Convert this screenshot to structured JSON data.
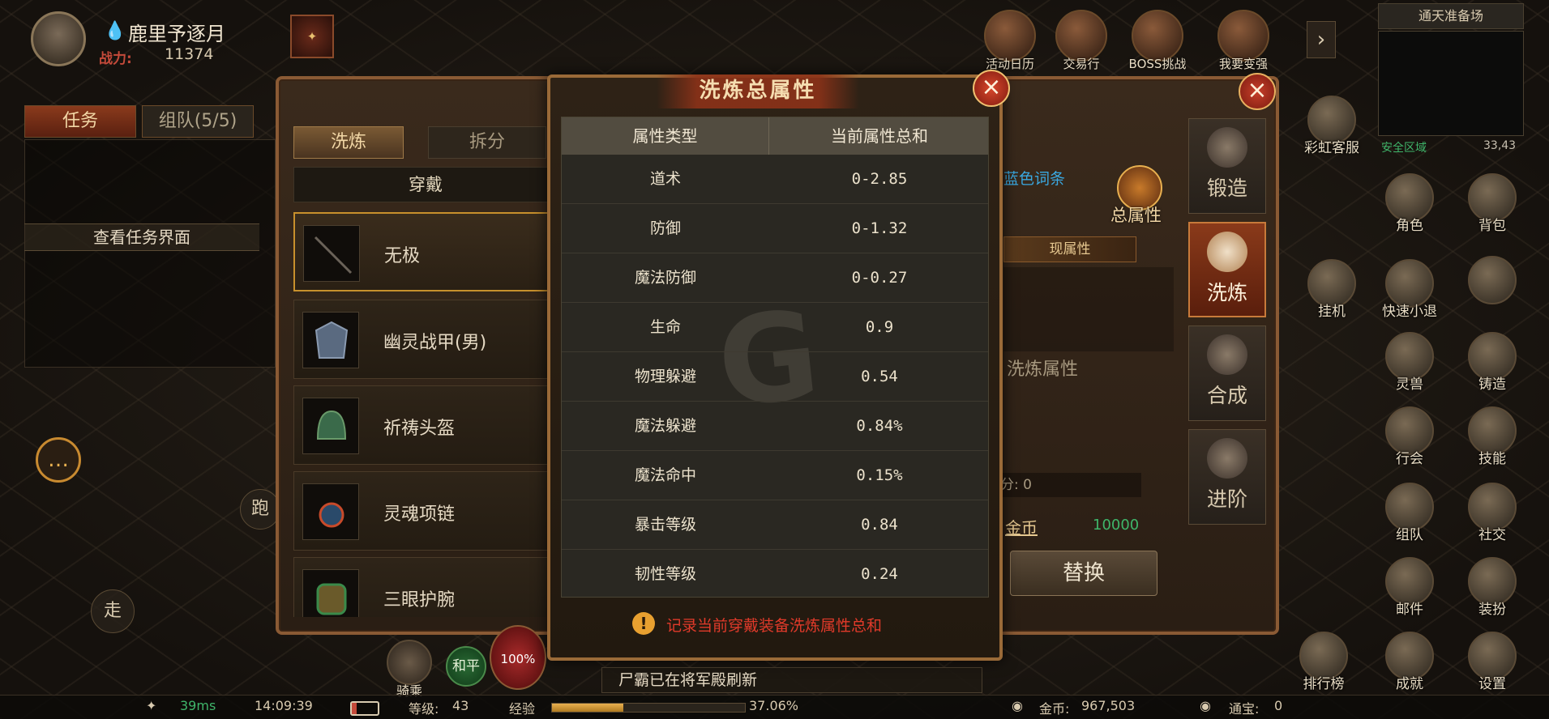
{
  "player": {
    "name": "鹿里予逐月",
    "power_label": "战力:",
    "power_value": "11374",
    "buff_icon": "buff-icon"
  },
  "top_icons": [
    {
      "label": "活动日历",
      "icon": "calendar-icon"
    },
    {
      "label": "交易行",
      "icon": "trade-icon"
    },
    {
      "label": "BOSS挑战",
      "icon": "boss-icon"
    },
    {
      "label": "我要变强",
      "icon": "strengthen-icon"
    }
  ],
  "minimap": {
    "title": "通天准备场",
    "safe_zone": "安全区域",
    "coords": "33,43"
  },
  "customer_service": "彩虹客服",
  "task_panel": {
    "tab_tasks": "任务",
    "tab_team": "组队(5/5)",
    "view_tasks": "查看任务界面"
  },
  "controls": {
    "run": "跑",
    "walk": "走",
    "mount": "骑乘",
    "peace": "和平",
    "hp_percent": "100%"
  },
  "smelt_window": {
    "tab_smelt": "洗炼",
    "tab_split": "拆分",
    "wear_select": "穿戴",
    "items": [
      {
        "name": "无极",
        "icon": "staff-icon"
      },
      {
        "name": "幽灵战甲(男)",
        "icon": "armor-icon"
      },
      {
        "name": "祈祷头盔",
        "icon": "helmet-icon"
      },
      {
        "name": "灵魂项链",
        "icon": "necklace-icon"
      },
      {
        "name": "三眼护腕",
        "icon": "bracer-icon"
      }
    ],
    "blue_affix": "蓝色词条",
    "total_attr_label": "总属性",
    "current_attr": "现属性",
    "smelt_attr": "洗炼属性",
    "points": "分: 0",
    "gold_label": "金币",
    "gold_cost": "10000",
    "replace_button": "替换"
  },
  "side_tabs": [
    {
      "label": "锻造",
      "icon": "forge-icon"
    },
    {
      "label": "洗炼",
      "icon": "smelt-icon"
    },
    {
      "label": "合成",
      "icon": "compose-icon"
    },
    {
      "label": "进阶",
      "icon": "advance-icon"
    }
  ],
  "game_icons": {
    "role": "角色",
    "bag": "背包",
    "afk": "挂机",
    "quick_exit": "快速小退",
    "close": "",
    "spirit_beast": "灵兽",
    "craft": "铸造",
    "guild": "行会",
    "skill": "技能",
    "team": "组队",
    "social": "社交",
    "mail": "邮件",
    "dress": "装扮",
    "ranking": "排行榜",
    "achievement": "成就",
    "settings": "设置"
  },
  "dialog": {
    "title": "洗炼总属性",
    "header_type": "属性类型",
    "header_total": "当前属性总和",
    "rows": [
      {
        "type": "道术",
        "value": "0-2.85"
      },
      {
        "type": "防御",
        "value": "0-1.32"
      },
      {
        "type": "魔法防御",
        "value": "0-0.27"
      },
      {
        "type": "生命",
        "value": "0.9"
      },
      {
        "type": "物理躲避",
        "value": "0.54"
      },
      {
        "type": "魔法躲避",
        "value": "0.84%"
      },
      {
        "type": "魔法命中",
        "value": "0.15%"
      },
      {
        "type": "暴击等级",
        "value": "0.84"
      },
      {
        "type": "韧性等级",
        "value": "0.24"
      }
    ],
    "note": "记录当前穿戴装备洗炼属性总和",
    "watermark": "G"
  },
  "news": "尸霸已在将军殿刷新",
  "status_bar": {
    "ping": "39ms",
    "time": "14:09:39",
    "level_label": "等级:",
    "level": "43",
    "exp_label": "经验",
    "exp_percent": "37.06%",
    "exp_fraction": 0.3706,
    "gold_label": "金币:",
    "gold": "967,503",
    "ingot_label": "通宝:",
    "ingot": "0"
  },
  "colors": {
    "accent_gold": "#c8902c",
    "warning_red": "#e03a2a",
    "safe_green": "#3fb56a",
    "affix_blue": "#3aa8e0"
  }
}
